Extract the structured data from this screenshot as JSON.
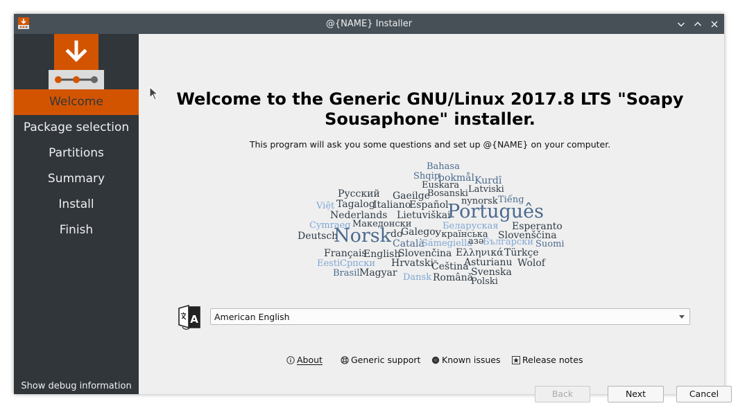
{
  "window": {
    "title": "@{NAME} Installer"
  },
  "sidebar": {
    "steps": [
      "Welcome",
      "Package selection",
      "Partitions",
      "Summary",
      "Install",
      "Finish"
    ],
    "active_step": 0,
    "debug_label": "Show debug information"
  },
  "main": {
    "title": "Welcome to the Generic GNU/Linux 2017.8 LTS \"Soapy Sousaphone\" installer.",
    "subtitle": "This program will ask you some questions and set up @{NAME} on your computer.",
    "language": {
      "selected": "American English"
    },
    "links": {
      "about": "About",
      "support": "Generic support",
      "known_issues": "Known issues",
      "release_notes": "Release notes"
    },
    "buttons": {
      "back": "Back",
      "next": "Next",
      "cancel": "Cancel"
    },
    "language_cloud": [
      "Bahasa",
      "Shqip",
      "bokmål",
      "Kurdî",
      "Euskara",
      "Latviski",
      "Русский",
      "Gaeilge",
      "Bosanski",
      "Tiếng",
      "Việt",
      "Tagalog",
      "Italiano",
      "Español",
      "nynorsk",
      "Nederlands",
      "Lietuviškai",
      "Português",
      "Cymraeg",
      "Македонски",
      "Беларуская",
      "Esperanto",
      "Deutsch",
      "Norsk",
      "do",
      "Galego",
      "Українська",
      "Slovenščina",
      "Català",
      "Sámegiella",
      "азә",
      "Български",
      "Suomi",
      "Français",
      "English",
      "Slovenčina",
      "Ελληνικά",
      "Türkçe",
      "Eesti",
      "Српски",
      "Hrvatski",
      "Asturianu",
      "Wolof",
      "Brasil",
      "Magyar",
      "Čeština",
      "Dansk",
      "Svenska",
      "Română",
      "Polski"
    ]
  },
  "colors": {
    "accent": "#d35400",
    "sidebar_bg": "#31363b",
    "titlebar_bg": "#475057"
  }
}
